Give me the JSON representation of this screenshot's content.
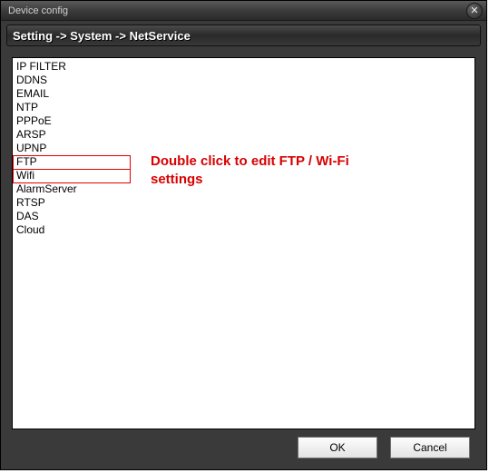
{
  "window": {
    "title": "Device config"
  },
  "breadcrumb": {
    "text": "Setting -> System -> NetService"
  },
  "list": {
    "items": [
      "IP FILTER",
      "DDNS",
      "EMAIL",
      "NTP",
      "PPPoE",
      "ARSP",
      "UPNP",
      "FTP",
      "Wifi",
      "AlarmServer",
      "RTSP",
      "DAS",
      "Cloud"
    ]
  },
  "annotation": {
    "text": "Double click to edit FTP / Wi-Fi settings"
  },
  "buttons": {
    "ok": "OK",
    "cancel": "Cancel"
  }
}
